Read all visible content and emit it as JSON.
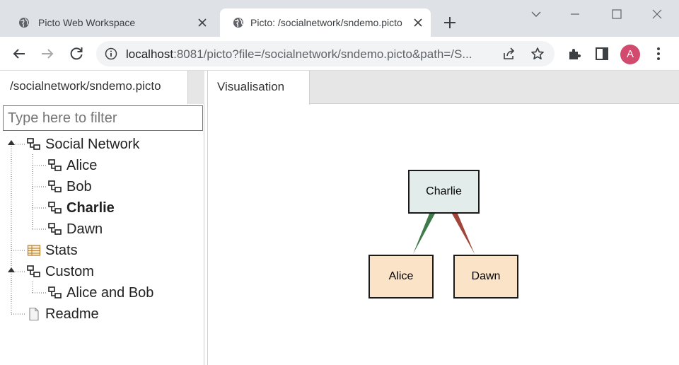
{
  "browser": {
    "tabs": [
      {
        "title": "Picto Web Workspace",
        "icon": "globe-icon",
        "active": false
      },
      {
        "title": "Picto: /socialnetwork/sndemo.picto",
        "icon": "globe-icon",
        "active": true
      }
    ],
    "url_host": "localhost",
    "url_rest": ":8081/picto?file=/socialnetwork/sndemo.picto&path=/S...",
    "profile_initial": "A",
    "profile_color": "#d24a6e"
  },
  "left_panel": {
    "tab_label": "/socialnetwork/sndemo.picto",
    "filter_placeholder": "Type here to filter",
    "tree": [
      {
        "label": "Social Network",
        "icon": "diagram-icon",
        "expanded": true
      },
      {
        "label": "Alice",
        "icon": "diagram-icon"
      },
      {
        "label": "Bob",
        "icon": "diagram-icon"
      },
      {
        "label": "Charlie",
        "icon": "diagram-icon",
        "selected": true
      },
      {
        "label": "Dawn",
        "icon": "diagram-icon"
      },
      {
        "label": "Stats",
        "icon": "table-icon"
      },
      {
        "label": "Custom",
        "icon": "diagram-icon",
        "expanded": true
      },
      {
        "label": "Alice and Bob",
        "icon": "diagram-icon"
      },
      {
        "label": "Readme",
        "icon": "document-icon"
      }
    ]
  },
  "right_panel": {
    "tab_label": "Visualisation",
    "graph": {
      "nodes": [
        {
          "id": "charlie",
          "label": "Charlie",
          "fill": "#e2eceb"
        },
        {
          "id": "alice",
          "label": "Alice",
          "fill": "#fbe3c8"
        },
        {
          "id": "dawn",
          "label": "Dawn",
          "fill": "#fbe3c8"
        }
      ],
      "edges": [
        {
          "from": "charlie",
          "to": "alice",
          "color": "#3f7a4a"
        },
        {
          "from": "charlie",
          "to": "dawn",
          "color": "#a0453a"
        }
      ]
    }
  }
}
